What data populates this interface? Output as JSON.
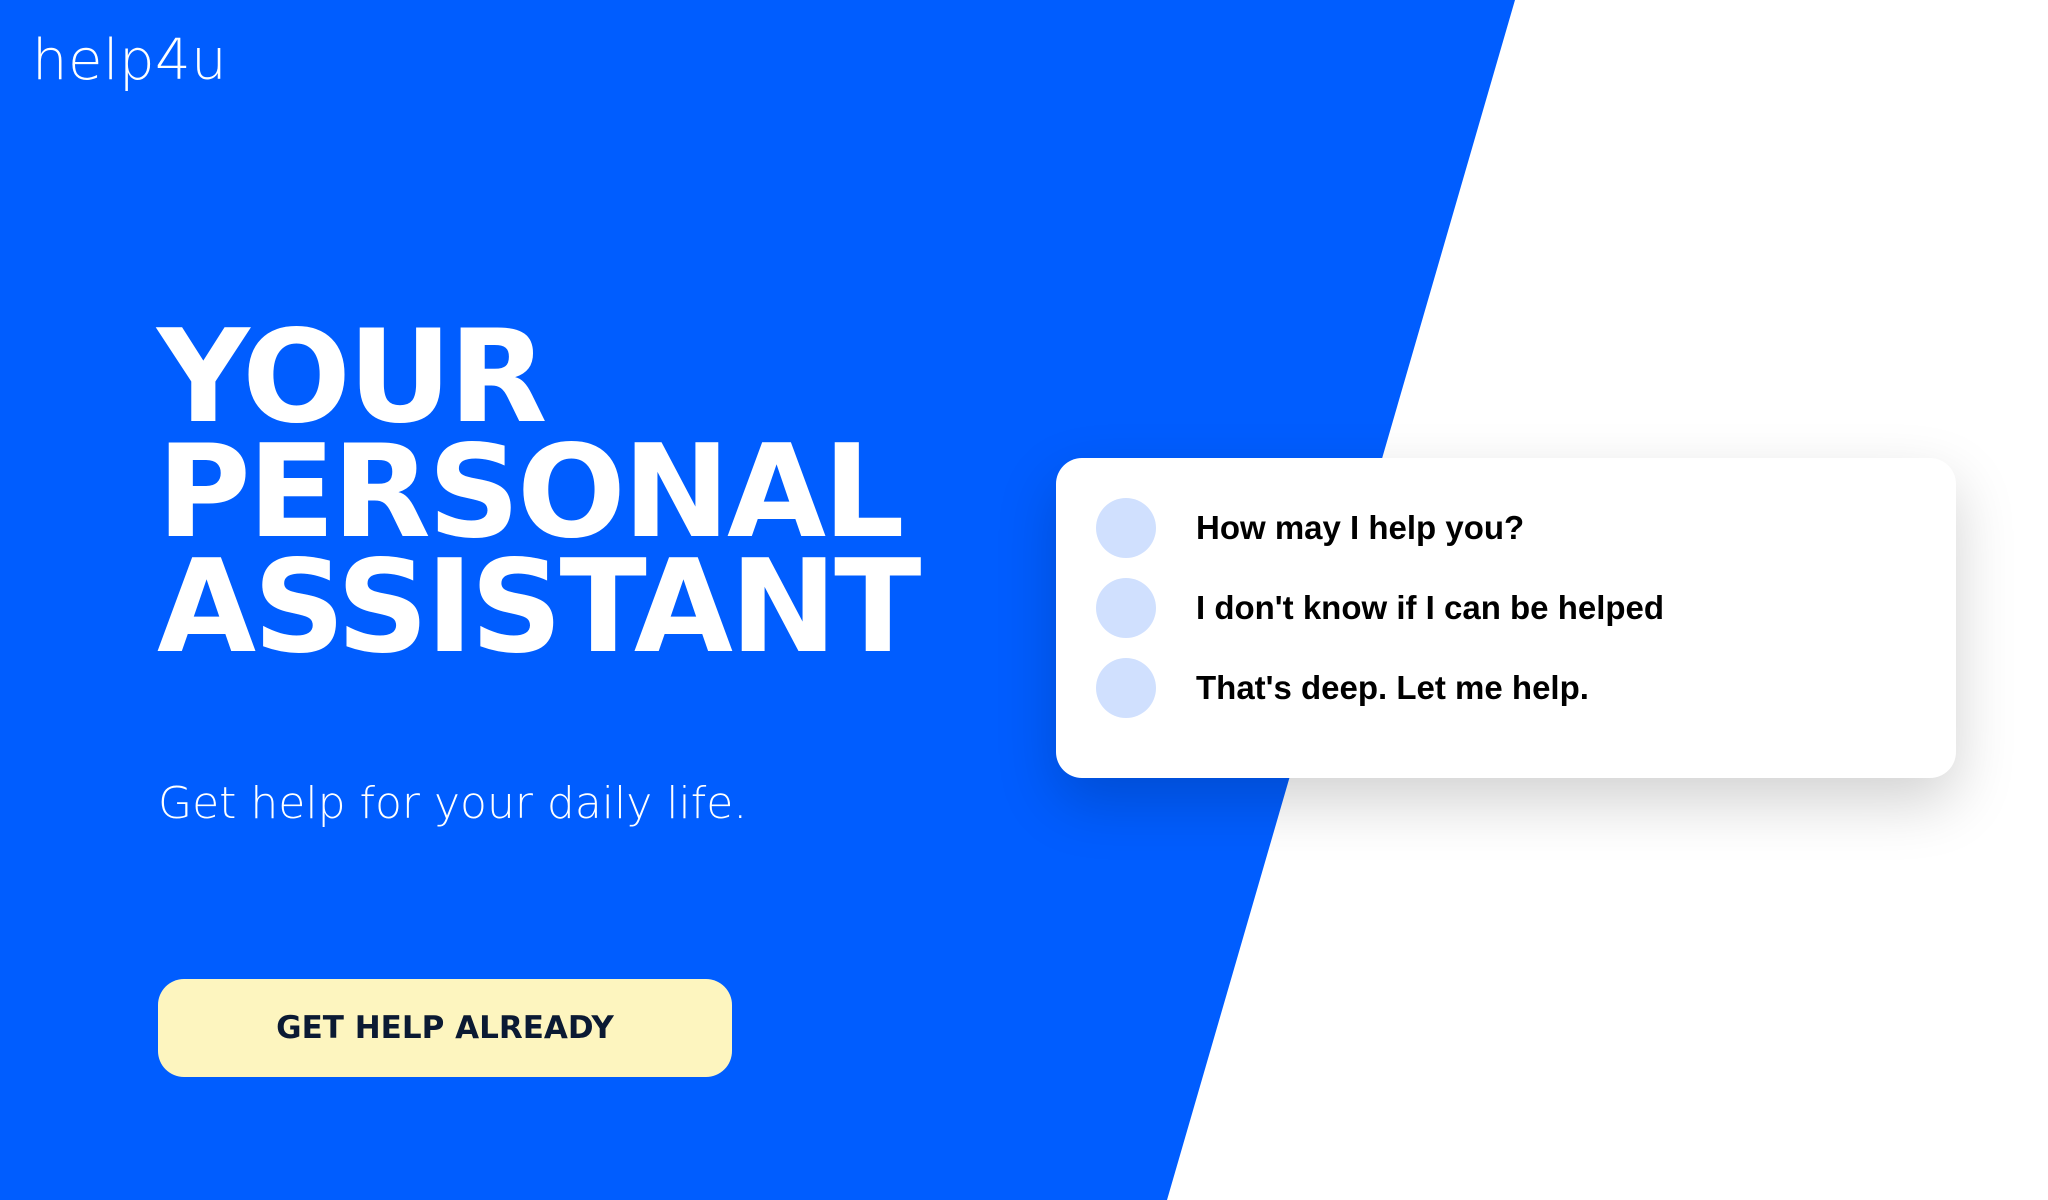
{
  "brand": {
    "logo_text": "help4u"
  },
  "hero": {
    "headline_lines": [
      "YOUR",
      "PERSONAL",
      "ASSISTANT"
    ],
    "subtitle": "Get help for your daily life.",
    "cta_label": "GET HELP ALREADY"
  },
  "chat": {
    "messages": [
      {
        "text": "How may I help you?",
        "icon": "avatar-icon"
      },
      {
        "text": "I don't know if I can be helped",
        "icon": "avatar-icon"
      },
      {
        "text": "That's deep. Let me help.",
        "icon": "avatar-icon"
      }
    ]
  },
  "colors": {
    "primary_blue": "#005dff",
    "background": "#ffffff",
    "cta_background": "#fdf5bf",
    "cta_text": "#0b1a33",
    "avatar": "#d0e0fe"
  }
}
